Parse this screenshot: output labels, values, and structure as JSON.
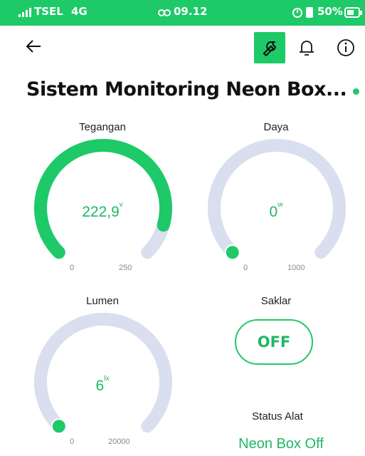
{
  "status_bar": {
    "carrier": "TSEL",
    "network": "4G",
    "time": "09.12",
    "battery": "50%"
  },
  "toolbar": {
    "back_icon": "arrow-left-icon",
    "settings_icon": "wrench-icon",
    "notifications_icon": "bell-icon",
    "info_icon": "info-icon"
  },
  "header": {
    "title": "Sistem Monitoring Neon Box...",
    "status_color": "#1ec968"
  },
  "gauges": [
    {
      "label": "Tegangan",
      "value": "222,9",
      "unit": "V",
      "min": "0",
      "max": "250",
      "fraction": 0.892
    },
    {
      "label": "Daya",
      "value": "0",
      "unit": "W",
      "min": "0",
      "max": "1000",
      "fraction": 0
    },
    {
      "label": "Lumen",
      "value": "6",
      "unit": "lx",
      "min": "0",
      "max": "20000",
      "fraction": 0.0003
    }
  ],
  "switch": {
    "label": "Saklar",
    "state": "OFF"
  },
  "device_status": {
    "label": "Status Alat",
    "value": "Neon Box Off"
  },
  "colors": {
    "accent": "#1ec968",
    "track": "#d9dfee",
    "text_green": "#1eb865"
  }
}
